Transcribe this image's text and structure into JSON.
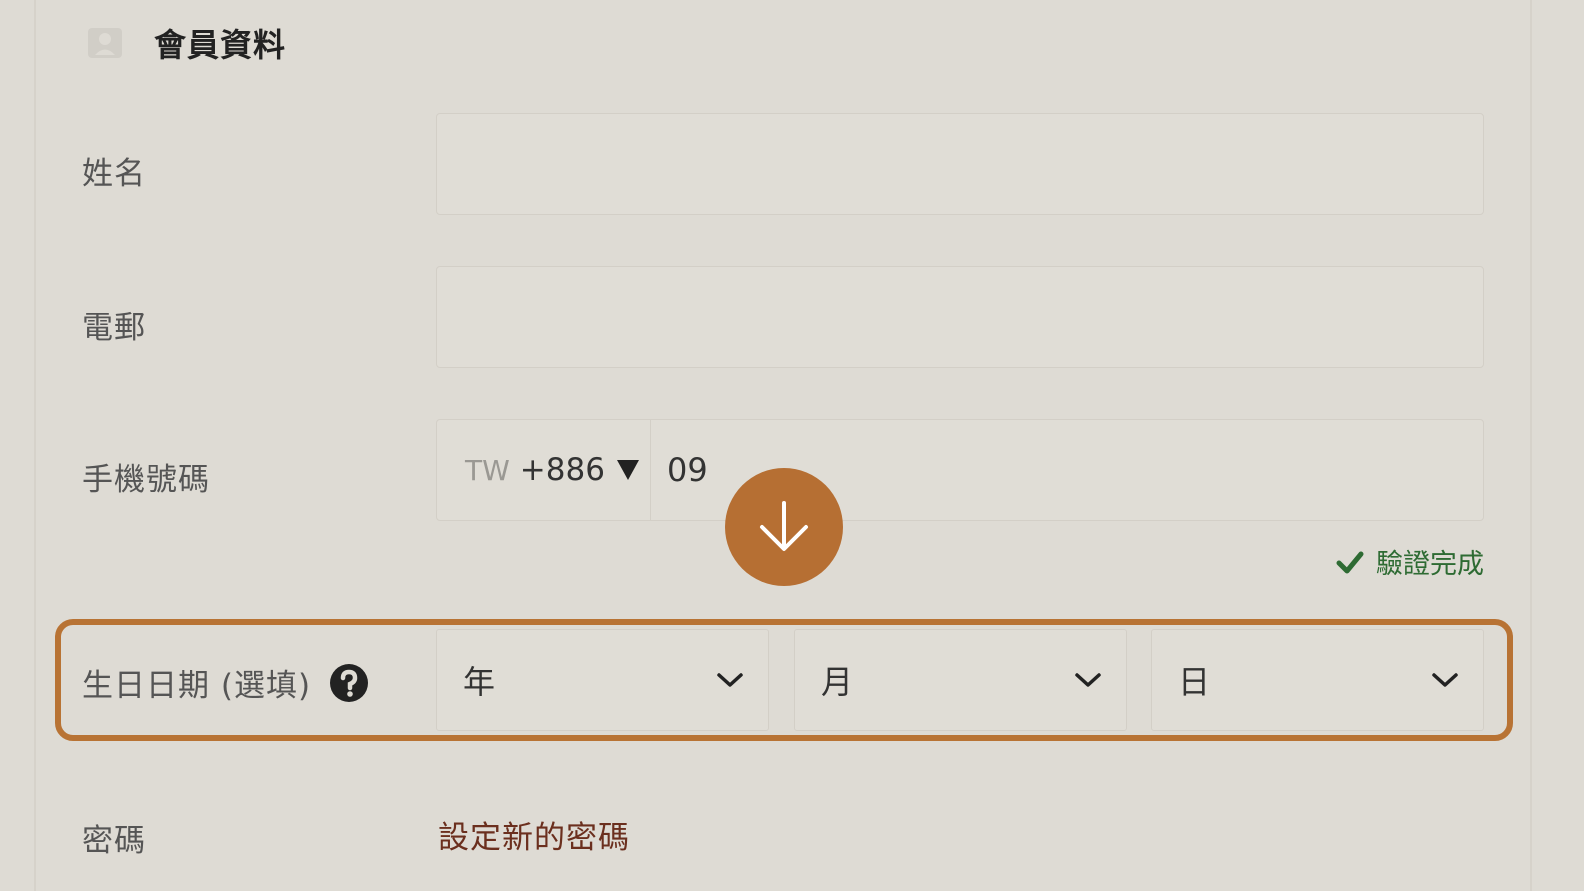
{
  "section": {
    "title": "會員資料",
    "icon": "person-icon"
  },
  "fields": {
    "name": {
      "label": "姓名",
      "value": ""
    },
    "email": {
      "label": "電郵",
      "value": ""
    },
    "phone": {
      "label": "手機號碼",
      "country_abbr": "TW",
      "dial_code": "+886",
      "value": "09",
      "verified_text": "驗證完成"
    },
    "birthday": {
      "label": "生日日期 (選填)",
      "year_placeholder": "年",
      "month_placeholder": "月",
      "day_placeholder": "日"
    },
    "password": {
      "label": "密碼",
      "link_text": "設定新的密碼"
    }
  },
  "colors": {
    "background": "#dedbd4",
    "accent": "#b87334",
    "verified": "#2e6b33",
    "link": "#6b2f1e"
  }
}
